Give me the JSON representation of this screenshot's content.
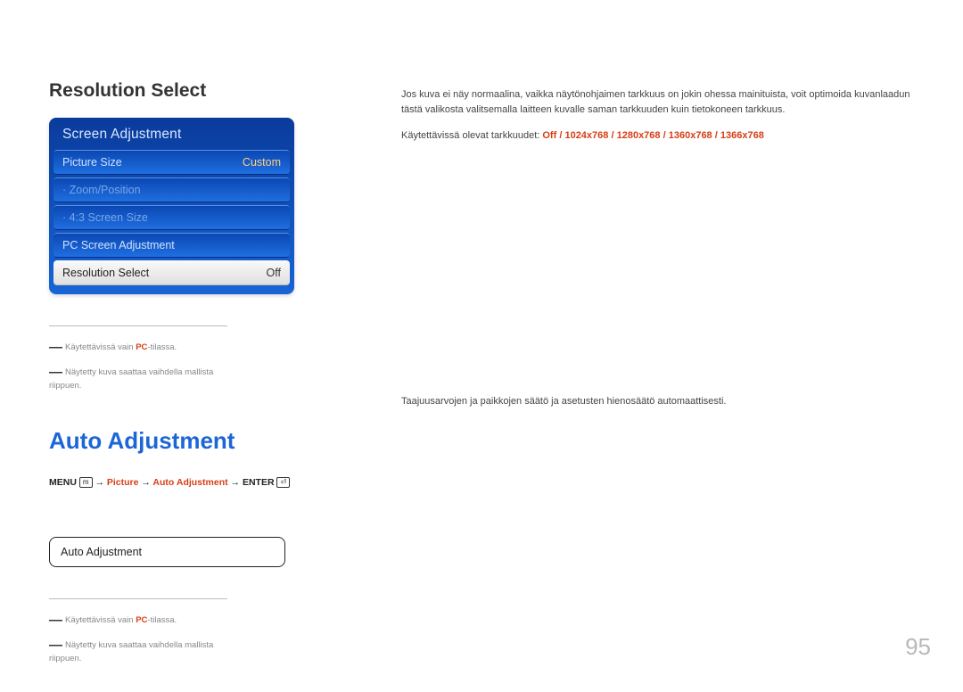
{
  "page_number": "95",
  "section1": {
    "title": "Resolution Select",
    "osd": {
      "header": "Screen Adjustment",
      "rows": [
        {
          "label": "Picture Size",
          "value": "Custom",
          "kind": "normal"
        },
        {
          "label": "· Zoom/Position",
          "value": "",
          "kind": "dim"
        },
        {
          "label": "· 4:3 Screen Size",
          "value": "",
          "kind": "dim"
        },
        {
          "label": "PC Screen Adjustment",
          "value": "",
          "kind": "normal"
        },
        {
          "label": "Resolution Select",
          "value": "Off",
          "kind": "selected"
        }
      ]
    },
    "notes": {
      "n1_pre": "Käytettävissä vain ",
      "n1_pc": "PC",
      "n1_post": "-tilassa.",
      "n2": "Näytetty kuva saattaa vaihdella mallista riippuen."
    },
    "body": "Jos kuva ei näy normaalina, vaikka näytönohjaimen tarkkuus on jokin ohessa mainituista, voit optimoida kuvanlaadun tästä valikosta valitsemalla laitteen kuvalle saman tarkkuuden kuin tietokoneen tarkkuus.",
    "res_label": "Käytettävissä olevat tarkkuudet: ",
    "res_options": [
      "Off",
      "1024x768",
      "1280x768",
      "1360x768",
      "1366x768"
    ]
  },
  "section2": {
    "title": "Auto Adjustment",
    "menu_path": {
      "menu": "MENU",
      "arrow": "→",
      "p1": "Picture",
      "p2": "Auto Adjustment",
      "enter": "ENTER"
    },
    "pill_label": "Auto Adjustment",
    "body": "Taajuusarvojen ja paikkojen säätö ja asetusten hienosäätö automaattisesti.",
    "notes": {
      "n1_pre": "Käytettävissä vain ",
      "n1_pc": "PC",
      "n1_post": "-tilassa.",
      "n2": "Näytetty kuva saattaa vaihdella mallista riippuen."
    }
  }
}
